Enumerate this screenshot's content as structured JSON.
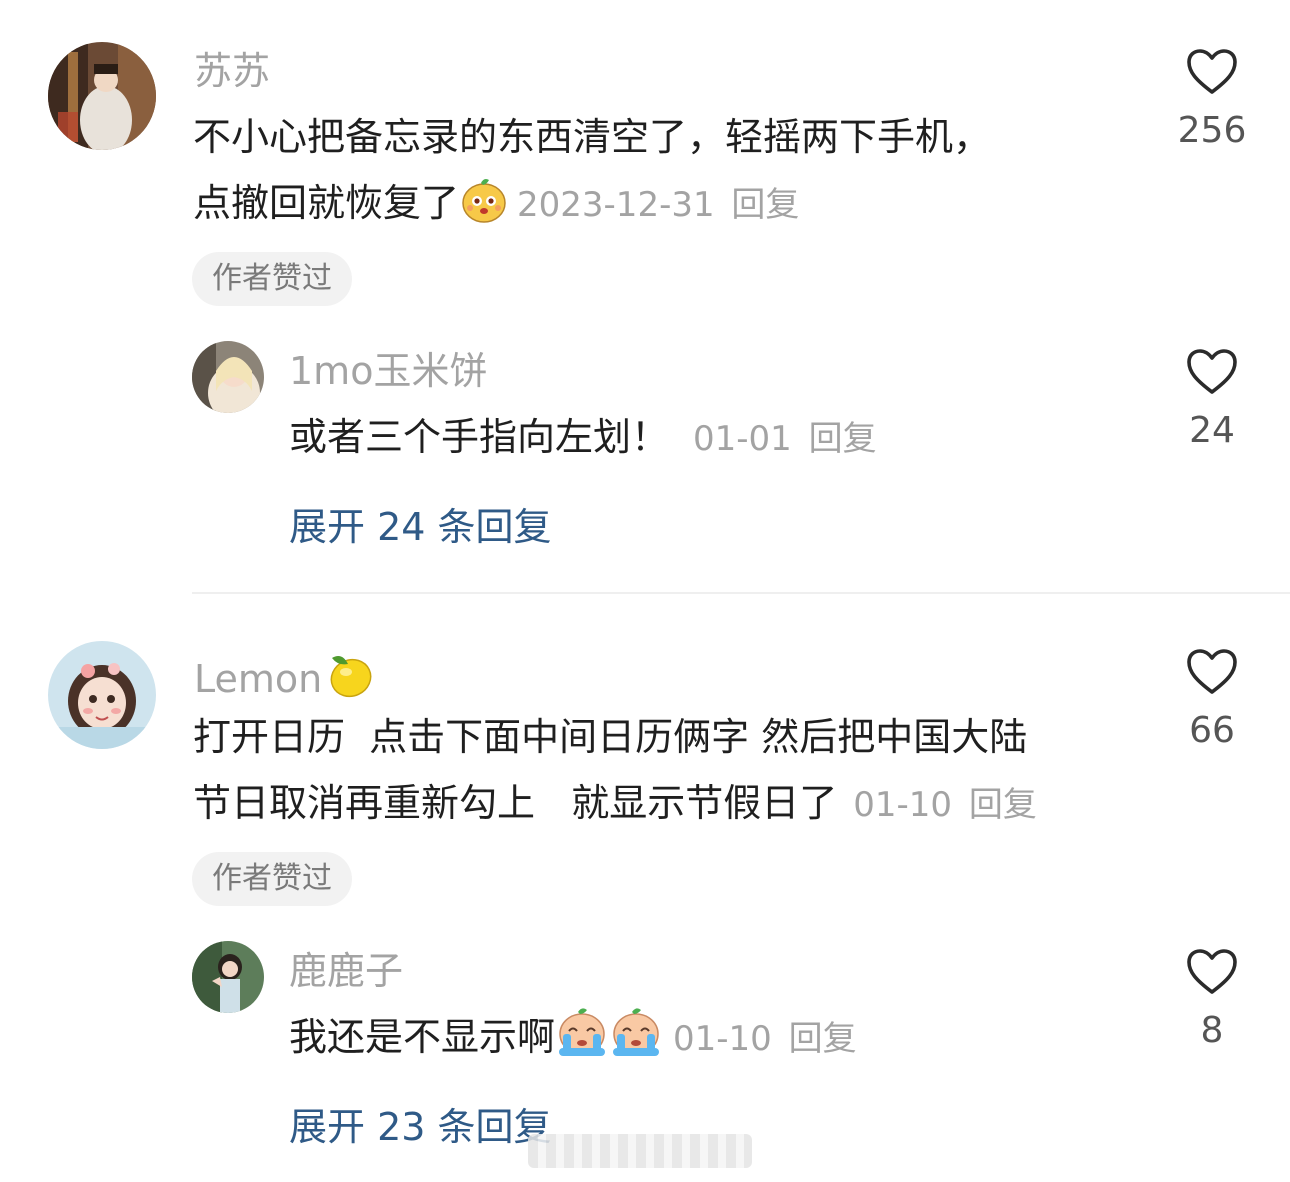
{
  "comments": [
    {
      "username": "苏苏",
      "text_line1": "不小心把备忘录的东西清空了，轻摇两下手机，",
      "text_line2": "点撤回就恢复了",
      "date": "2023-12-31",
      "reply_label": "回复",
      "likes": "256",
      "badge": "作者赞过",
      "reply": {
        "username": "1mo玉米饼",
        "text": "或者三个手指向左划！",
        "date": "01-01",
        "reply_label": "回复",
        "likes": "24"
      },
      "expand_label": "展开 24 条回复"
    },
    {
      "username": "Lemon",
      "text_line1": "打开日历  点击下面中间日历俩字 然后把中国大陆",
      "text_line2": "节日取消再重新勾上   就显示节假日了",
      "date": "01-10",
      "reply_label": "回复",
      "likes": "66",
      "badge": "作者赞过",
      "reply": {
        "username": "鹿鹿子",
        "text": "我还是不显示啊",
        "date": "01-10",
        "reply_label": "回复",
        "likes": "8"
      },
      "expand_label": "展开 23 条回复"
    }
  ],
  "icons": {
    "like": "heart-outline-icon",
    "emoji1": "cute-face-emoji",
    "emoji2": "lemon-emoji",
    "emoji3": "crying-face-emoji"
  },
  "colors": {
    "username": "#a3a3a3",
    "expand_link": "#2f5a87",
    "badge_bg": "#f2f2f2"
  }
}
